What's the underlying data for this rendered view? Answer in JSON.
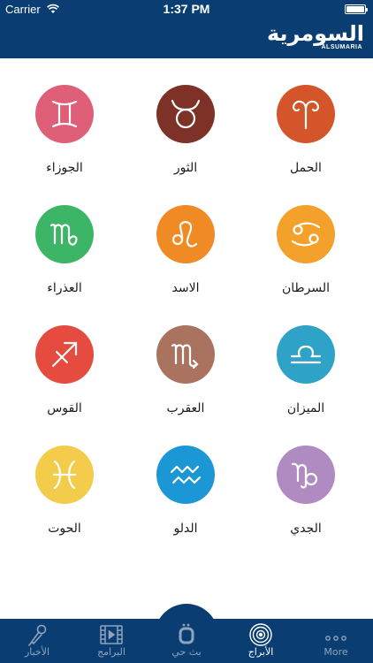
{
  "status_bar": {
    "carrier": "Carrier",
    "time": "1:37 PM"
  },
  "header": {
    "logo_ar": "السومرية",
    "logo_en": "ALSUMARIA"
  },
  "zodiac": [
    {
      "label": "الحمل",
      "icon": "aries-icon",
      "color": "#d4552a"
    },
    {
      "label": "الثور",
      "icon": "taurus-icon",
      "color": "#7e3227"
    },
    {
      "label": "الجوزاء",
      "icon": "gemini-icon",
      "color": "#df5e78"
    },
    {
      "label": "السرطان",
      "icon": "cancer-icon",
      "color": "#f3a12a"
    },
    {
      "label": "الاسد",
      "icon": "leo-icon",
      "color": "#f08a24"
    },
    {
      "label": "العذراء",
      "icon": "virgo-icon",
      "color": "#3db567"
    },
    {
      "label": "الميزان",
      "icon": "libra-icon",
      "color": "#2fa2c8"
    },
    {
      "label": "العقرب",
      "icon": "scorpio-icon",
      "color": "#aa7360"
    },
    {
      "label": "القوس",
      "icon": "sagittarius-icon",
      "color": "#e54b3f"
    },
    {
      "label": "الجدي",
      "icon": "capricorn-icon",
      "color": "#b08bc2"
    },
    {
      "label": "الدلو",
      "icon": "aquarius-icon",
      "color": "#1c97d6"
    },
    {
      "label": "الحوت",
      "icon": "pisces-icon",
      "color": "#f3cc4b"
    }
  ],
  "tabs": [
    {
      "label": "الأخبار",
      "icon": "microphone-icon"
    },
    {
      "label": "البرامج",
      "icon": "film-icon"
    },
    {
      "label": "بث حي",
      "icon": "live-logo-icon"
    },
    {
      "label": "الأبراج",
      "icon": "zodiac-wheel-icon",
      "active": true
    },
    {
      "label": "More",
      "icon": "more-dots-icon"
    }
  ],
  "colors": {
    "header_bg": "#0a3e73",
    "tab_inactive": "#8fa4bd",
    "tab_active": "#ffffff"
  }
}
